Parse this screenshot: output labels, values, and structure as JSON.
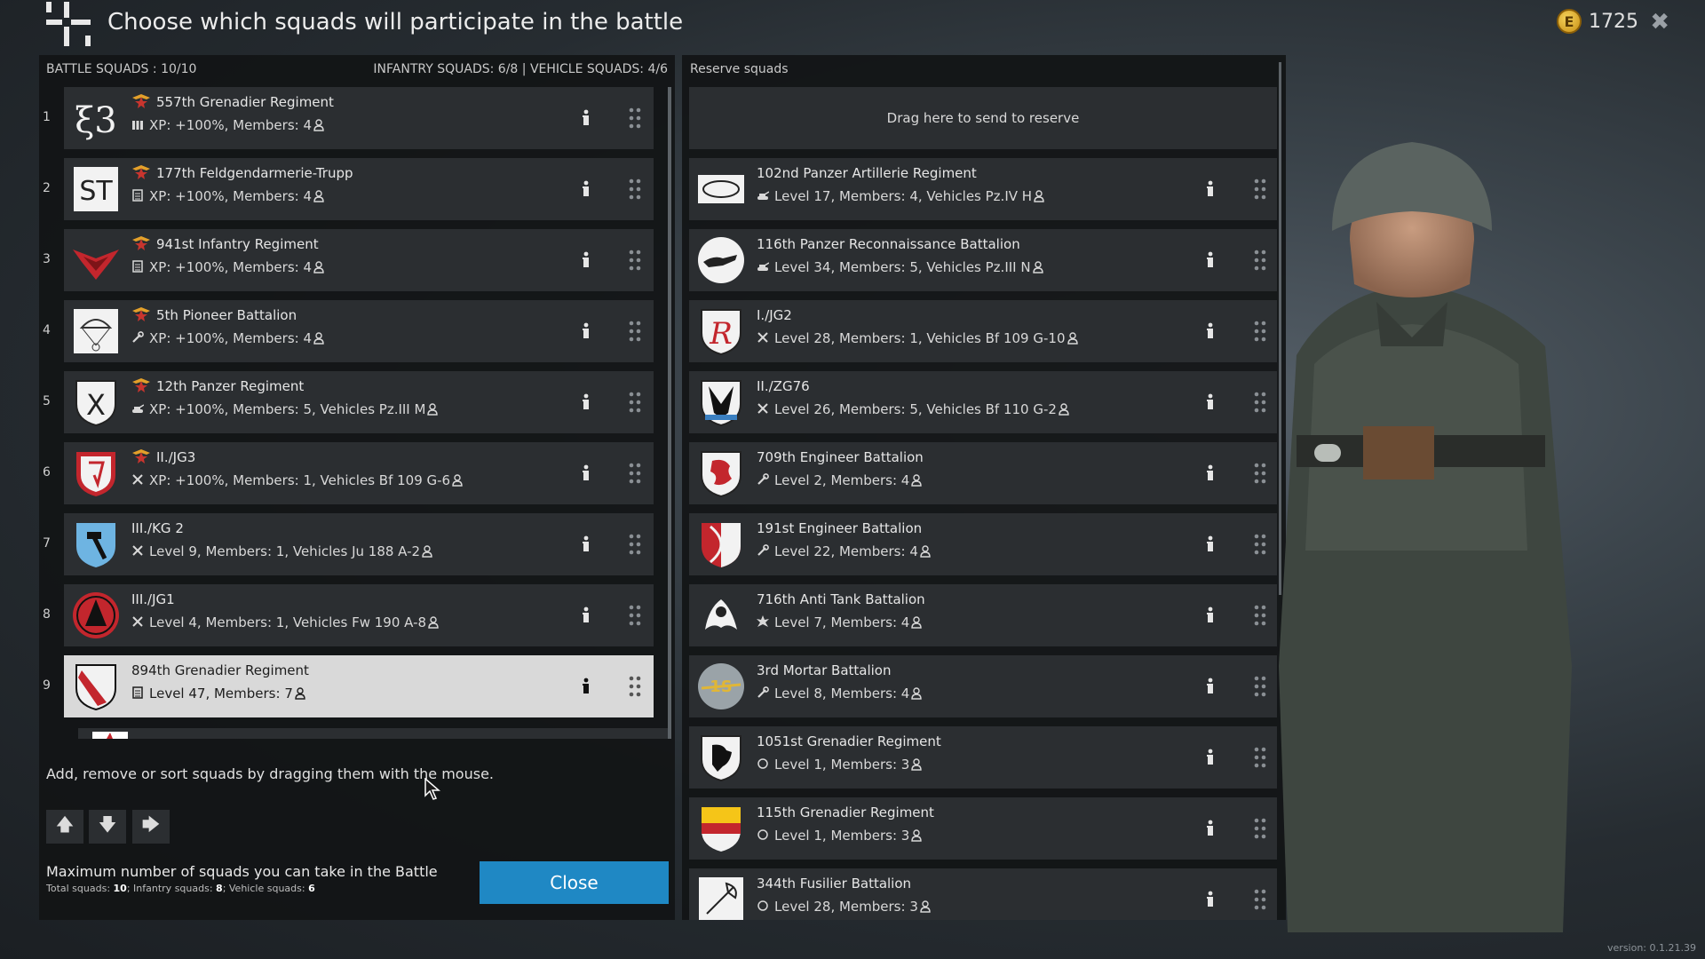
{
  "header": {
    "title": "Choose which squads will participate in the battle",
    "gold": "1725",
    "coin_letter": "E",
    "close_icon": "close-icon"
  },
  "battle": {
    "label": "BATTLE SQUADS : 10/10",
    "counts": "INFANTRY SQUADS: 6/8 | VEHICLE SQUADS: 4/6",
    "squads": [
      {
        "num": "1",
        "name": "557th Grenadier Regiment",
        "stats": "XP: +100%, Members: 4",
        "premium": true,
        "type_icon": "machinegun-icon",
        "emblem": "e13"
      },
      {
        "num": "2",
        "name": "177th Feldgendarmerie-Trupp",
        "stats": "XP: +100%, Members: 4",
        "premium": true,
        "type_icon": "rifle-icon",
        "emblem": "st"
      },
      {
        "num": "3",
        "name": "941st Infantry Regiment",
        "stats": "XP: +100%, Members: 4",
        "premium": true,
        "type_icon": "rifle-icon",
        "emblem": "redwing"
      },
      {
        "num": "4",
        "name": "5th Pioneer Battalion",
        "stats": "XP: +100%, Members: 4",
        "premium": true,
        "type_icon": "wrench-icon",
        "emblem": "parachute"
      },
      {
        "num": "5",
        "name": "12th Panzer Regiment",
        "stats": "XP: +100%, Members: 5, Vehicles Pz.III M",
        "premium": true,
        "type_icon": "tank-icon",
        "emblem": "x-shield"
      },
      {
        "num": "6",
        "name": "II./JG3",
        "stats": "XP: +100%, Members: 1, Vehicles Bf 109 G-6",
        "premium": true,
        "type_icon": "plane-icon",
        "emblem": "red-shield"
      },
      {
        "num": "7",
        "name": "III./KG 2",
        "stats": "Level 9, Members: 1, Vehicles Ju 188 A-2",
        "premium": false,
        "type_icon": "plane-icon",
        "emblem": "hammer-shield"
      },
      {
        "num": "8",
        "name": "III./JG1",
        "stats": "Level 4, Members: 1, Vehicles Fw 190 A-8",
        "premium": false,
        "type_icon": "plane-icon",
        "emblem": "red-circle"
      },
      {
        "num": "9",
        "name": "894th Grenadier Regiment",
        "stats": "Level 47, Members: 7",
        "premium": false,
        "type_icon": "rifle-icon",
        "emblem": "striped-shield",
        "selected": true
      }
    ],
    "instructions": "Add, remove or sort squads by dragging them with the mouse.",
    "arrows": [
      "arrow-up-icon",
      "arrow-down-icon",
      "arrow-right-icon"
    ],
    "max_label": "Maximum number of squads you can take in the Battle",
    "max_total_label": "Total squads: ",
    "max_total": "10",
    "max_inf_label": "; Infantry squads: ",
    "max_inf": "8",
    "max_veh_label": "; Vehicle squads: ",
    "max_veh": "6",
    "close_label": "Close"
  },
  "reserve": {
    "label": "Reserve squads",
    "dropzone": "Drag here to send to reserve",
    "squads": [
      {
        "name": "102nd Panzer Artillerie Regiment",
        "stats": "Level 17, Members: 4, Vehicles Pz.IV H",
        "type_icon": "tank-icon",
        "emblem": "oval"
      },
      {
        "name": "116th Panzer Reconnaissance Battalion",
        "stats": "Level 34, Members: 5, Vehicles Pz.III N",
        "type_icon": "tank-icon",
        "emblem": "greyhound"
      },
      {
        "name": "I./JG2",
        "stats": "Level 28, Members: 1, Vehicles Bf 109 G-10",
        "type_icon": "plane-icon",
        "emblem": "r-shield"
      },
      {
        "name": "II./ZG76",
        "stats": "Level 26, Members: 5, Vehicles Bf 110 G-2",
        "type_icon": "plane-icon",
        "emblem": "eagle-shield"
      },
      {
        "name": "709th Engineer Battalion",
        "stats": "Level 2, Members: 4",
        "type_icon": "wrench-icon",
        "emblem": "lion-shield"
      },
      {
        "name": "191st Engineer Battalion",
        "stats": "Level 22, Members: 4",
        "type_icon": "wrench-icon",
        "emblem": "bow-shield"
      },
      {
        "name": "716th Anti Tank Battalion",
        "stats": "Level 7, Members: 4",
        "type_icon": "explosion-icon",
        "emblem": "oak"
      },
      {
        "name": "3rd  Mortar Battalion",
        "stats": "Level 8, Members: 4",
        "type_icon": "wrench-icon",
        "emblem": "mortar-badge"
      },
      {
        "name": "1051st Grenadier Regiment",
        "stats": "Level 1, Members: 3",
        "type_icon": "circle-icon",
        "emblem": "bear-shield"
      },
      {
        "name": "115th Grenadier Regiment",
        "stats": "Level 1, Members: 3",
        "type_icon": "circle-icon",
        "emblem": "flag-shield"
      },
      {
        "name": "344th Fusilier Battalion",
        "stats": "Level 28, Members: 3",
        "type_icon": "circle-icon",
        "emblem": "axe"
      }
    ]
  },
  "version": "version: 0.1.21.39"
}
